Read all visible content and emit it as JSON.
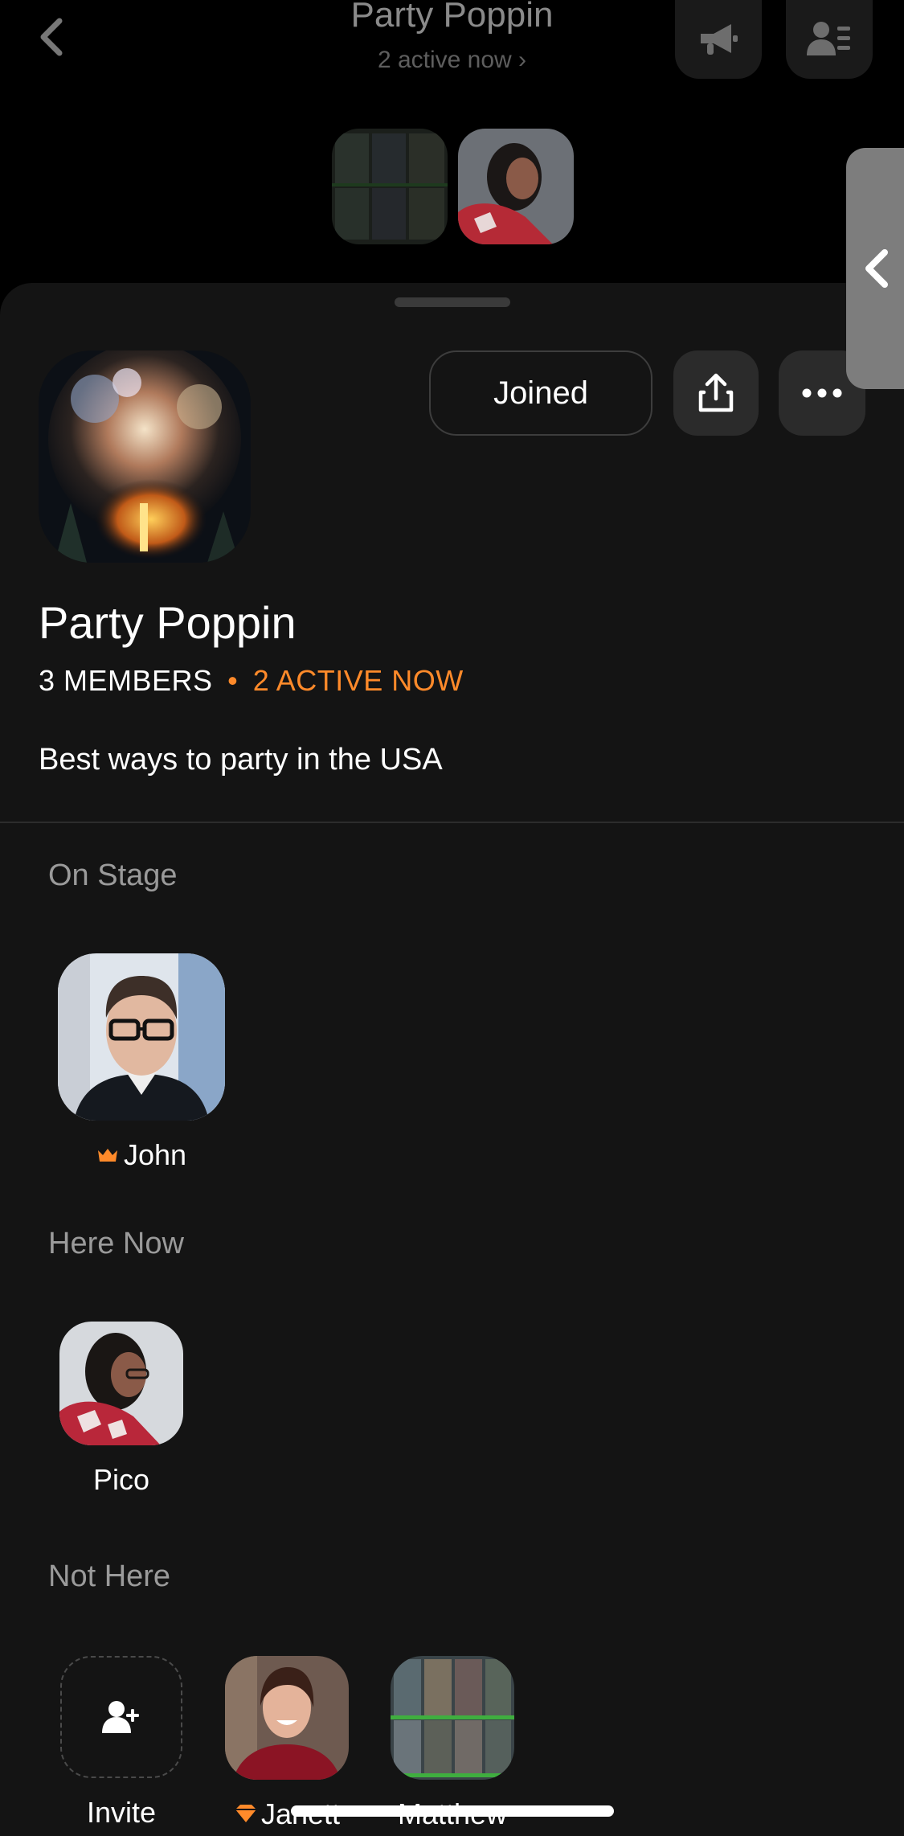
{
  "header": {
    "title": "Party Poppin",
    "subtitle": "2 active now ›",
    "back_icon": "chevron-left-icon",
    "announce_icon": "megaphone-icon",
    "members_icon": "members-list-icon"
  },
  "group": {
    "name": "Party Poppin",
    "members_count": "3 MEMBERS",
    "separator": "•",
    "active_now": "2 ACTIVE NOW",
    "description": "Best ways to party in the USA",
    "joined_label": "Joined",
    "share_icon": "share-icon",
    "more_icon": "more-horizontal-icon"
  },
  "sections": {
    "on_stage": "On Stage",
    "here_now": "Here Now",
    "not_here": "Not Here"
  },
  "on_stage": [
    {
      "name": "John",
      "badge": "crown-icon"
    }
  ],
  "here_now": [
    {
      "name": "Pico"
    }
  ],
  "not_here": [
    {
      "name": "Invite",
      "icon": "add-user-icon"
    },
    {
      "name": "Janett",
      "badge": "gem-icon"
    },
    {
      "name": "Matthew"
    }
  ],
  "colors": {
    "accent": "#ff8a2a",
    "sheet_bg": "#141414",
    "muted_text": "#9a9a9a"
  }
}
